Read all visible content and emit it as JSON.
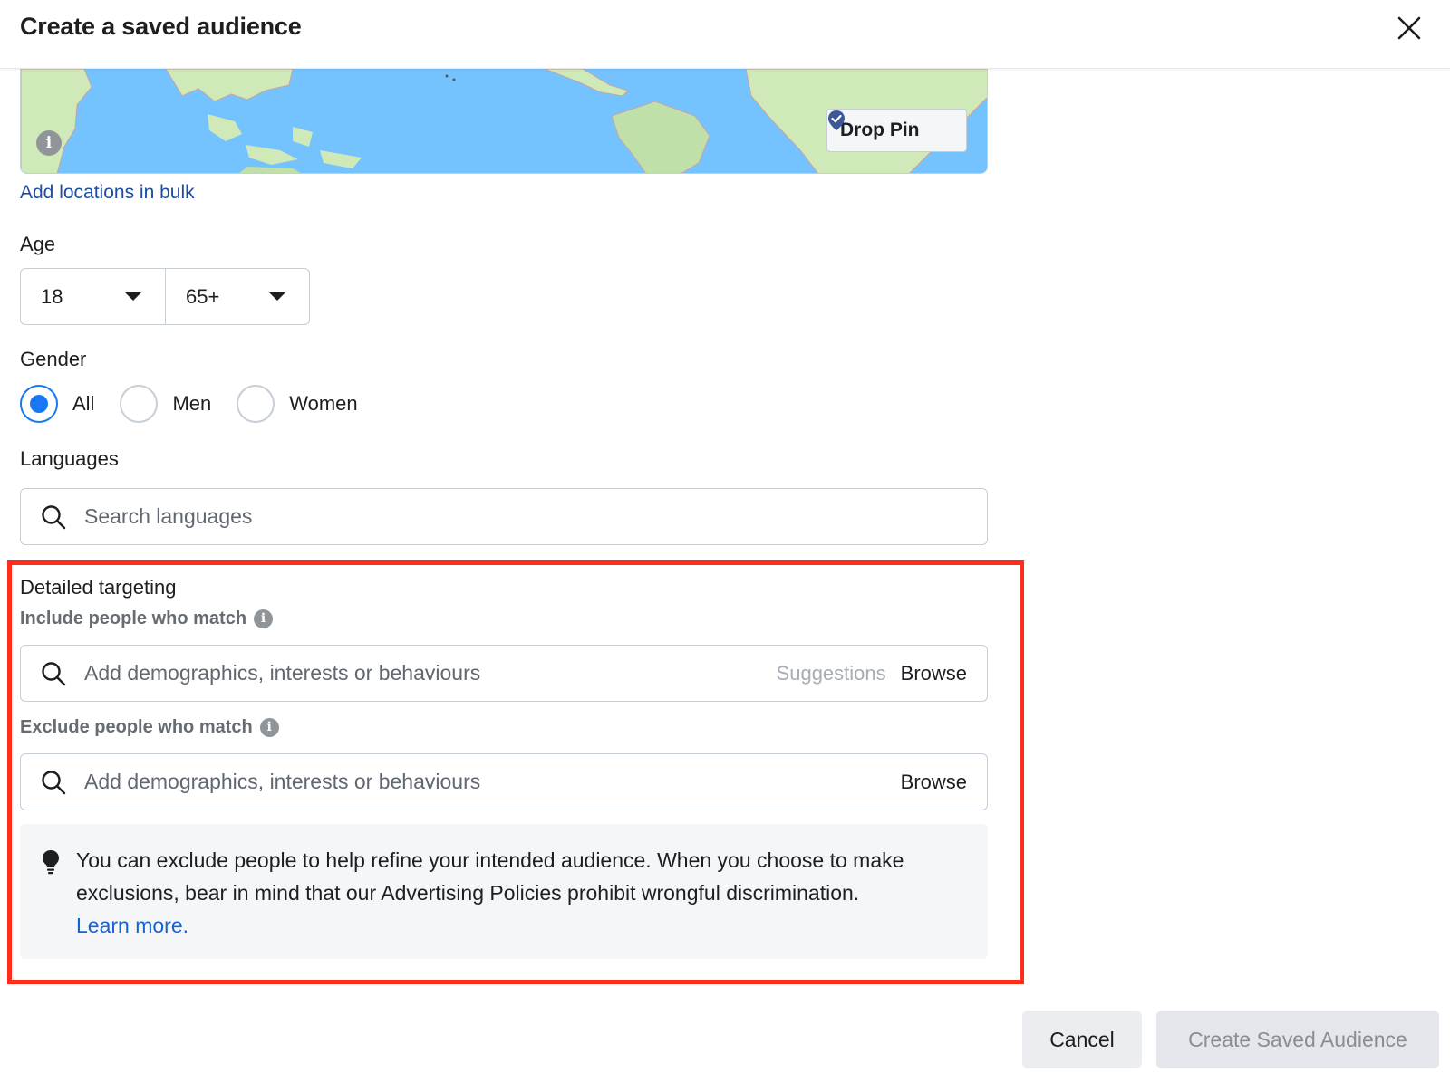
{
  "dialog": {
    "title": "Create a saved audience",
    "close_label": "Close"
  },
  "location": {
    "drop_pin_label": "Drop Pin",
    "info_glyph": "i",
    "add_bulk_label": "Add locations in bulk"
  },
  "age": {
    "label": "Age",
    "min": "18",
    "max": "65+"
  },
  "gender": {
    "label": "Gender",
    "options": [
      {
        "label": "All",
        "selected": true
      },
      {
        "label": "Men",
        "selected": false
      },
      {
        "label": "Women",
        "selected": false
      }
    ]
  },
  "languages": {
    "label": "Languages",
    "placeholder": "Search languages"
  },
  "detailed_targeting": {
    "label": "Detailed targeting",
    "include_label": "Include people who match",
    "include_placeholder": "Add demographics, interests or behaviours",
    "suggestions_label": "Suggestions",
    "browse_label": "Browse",
    "exclude_label": "Exclude people who match",
    "exclude_placeholder": "Add demographics, interests or behaviours",
    "info_glyph": "i",
    "notice_text": "You can exclude people to help refine your intended audience. When you choose to make exclusions, bear in mind that our Advertising Policies prohibit wrongful discrimination.",
    "learn_more_label": "Learn more."
  },
  "footer": {
    "cancel_label": "Cancel",
    "create_label": "Create Saved Audience"
  },
  "colors": {
    "accent": "#1877f2",
    "link": "#1d4ca0",
    "highlight": "#ff2d1a",
    "map_water": "#74c3ff"
  },
  "icons": [
    "close-icon",
    "map-pin-icon",
    "info-icon",
    "chevron-down-icon",
    "search-icon",
    "lightbulb-icon"
  ]
}
